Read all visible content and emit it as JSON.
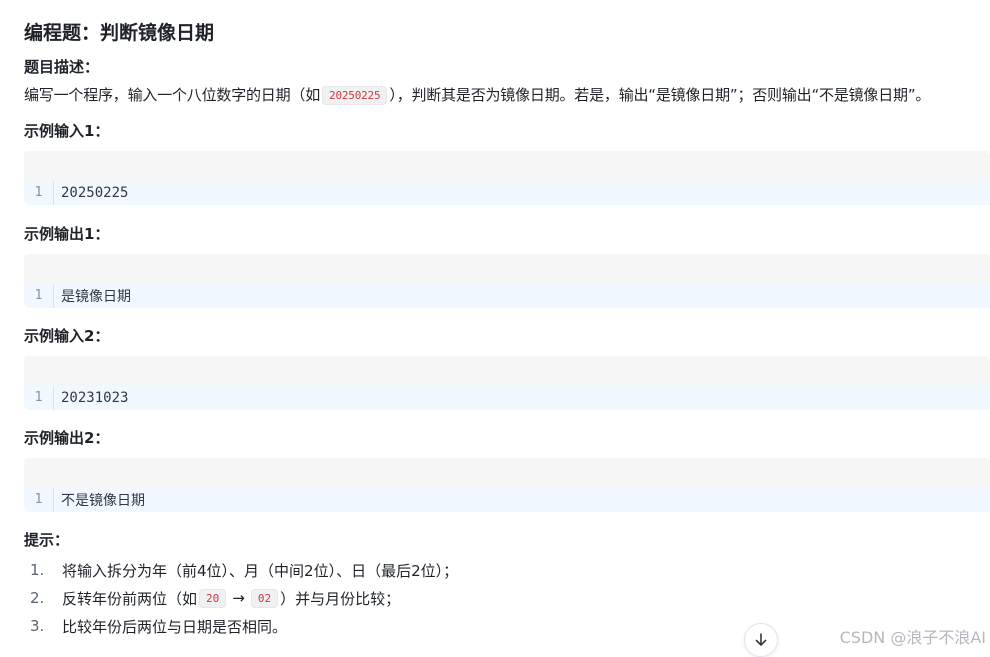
{
  "title": "编程题：判断镜像日期",
  "description": {
    "label": "题目描述：",
    "text_before": "编写一个程序，输入一个八位数字的日期（如",
    "code": "20250225",
    "text_after": "），判断其是否为镜像日期。若是，输出“是镜像日期”；否则输出“不是镜像日期”。"
  },
  "examples": [
    {
      "label": "示例输入1：",
      "line_no": "1",
      "content": "20250225"
    },
    {
      "label": "示例输出1：",
      "line_no": "1",
      "content": "是镜像日期"
    },
    {
      "label": "示例输入2：",
      "line_no": "1",
      "content": "20231023"
    },
    {
      "label": "示例输出2：",
      "line_no": "1",
      "content": "不是镜像日期"
    }
  ],
  "tips": {
    "label": "提示：",
    "items": [
      {
        "num": "1.",
        "text": "将输入拆分为年（前4位）、月（中间2位）、日（最后2位）；"
      },
      {
        "num": "2.",
        "text_before": "反转年份前两位（如",
        "code_a": "20",
        "arrow": "→",
        "code_b": "02",
        "text_after": "）并与月份比较；"
      },
      {
        "num": "3.",
        "text": "比较年份后两位与日期是否相同。"
      }
    ]
  },
  "scroll_button_icon": "arrow-down-icon",
  "watermark": "CSDN @浪子不浪AI"
}
